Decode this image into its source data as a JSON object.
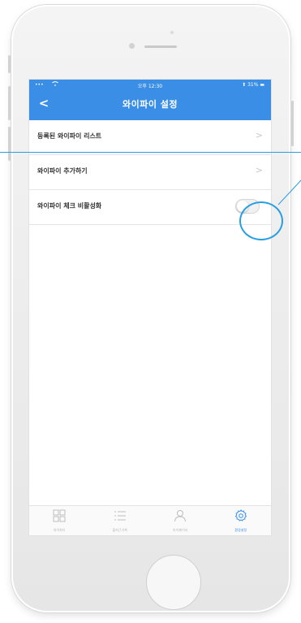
{
  "status_bar": {
    "signal": "•••",
    "wifi_icon": "wifi-icon",
    "time": "오후 12:30",
    "battery": "⬆ 31% ▬"
  },
  "header": {
    "back_icon": "chevron-left-icon",
    "back_glyph": "<",
    "title": "와이파이 설정"
  },
  "settings": [
    {
      "label": "등록된 와이파이 리스트",
      "control": "chevron",
      "chevron": ">"
    },
    {
      "label": "와이파이 추가하기",
      "control": "chevron",
      "chevron": ">"
    },
    {
      "label": "와이파이 체크 비활성화",
      "control": "toggle",
      "toggle_on": false
    }
  ],
  "tabbar": {
    "tabs": [
      {
        "icon": "grid-icon",
        "label": "와이파이",
        "active": false
      },
      {
        "icon": "list-icon",
        "label": "출퇴근기록",
        "active": false
      },
      {
        "icon": "person-icon",
        "label": "마이페이지",
        "active": false
      },
      {
        "icon": "gear-icon",
        "label": "환경설정",
        "active": true
      }
    ]
  },
  "colors": {
    "header_bg": "#3a8ee6",
    "active_tab": "#3a8ee6",
    "callout": "#2a9ee0"
  }
}
